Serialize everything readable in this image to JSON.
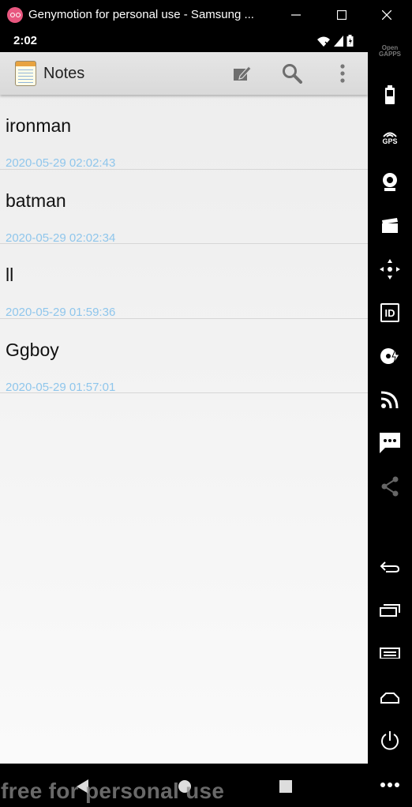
{
  "window": {
    "title": "Genymotion for personal use - Samsung ...",
    "logo_icon": "genymotion-logo-icon",
    "controls": [
      "minimize-icon",
      "maximize-icon",
      "close-icon"
    ]
  },
  "statusbar": {
    "time": "2:02",
    "icons": [
      "wifi-icon",
      "signal-icon",
      "battery-icon"
    ]
  },
  "actionbar": {
    "app_icon": "notepad-icon",
    "title": "Notes",
    "actions": [
      "new-note-icon",
      "search-icon",
      "overflow-menu-icon"
    ]
  },
  "notes": [
    {
      "title": "ironman",
      "date": "2020-05-29 02:02:43"
    },
    {
      "title": "batman",
      "date": "2020-05-29 02:02:34"
    },
    {
      "title": "ll",
      "date": "2020-05-29 01:59:36"
    },
    {
      "title": "Ggboy",
      "date": "2020-05-29 01:57:01"
    }
  ],
  "navbar": {
    "buttons": [
      "back-icon",
      "home-icon",
      "recents-icon"
    ],
    "watermark": "free for personal use"
  },
  "sidebar": {
    "opengapps_label": "Open GAPPS",
    "gps_label": "GPS",
    "id_label": "ID",
    "items": [
      "opengapps",
      "battery-icon",
      "gps-icon",
      "webcam-icon",
      "media-icon",
      "dpad-icon",
      "device-id-icon",
      "disk-io-icon",
      "network-icon",
      "sms-icon",
      "share-icon",
      "back-icon",
      "recent-apps-icon",
      "menu-icon",
      "home-icon",
      "power-icon",
      "more-icon"
    ]
  },
  "colors": {
    "date_text": "#8fc6ec",
    "watermark": "#8c8c8c",
    "logo": "#e8577f"
  }
}
